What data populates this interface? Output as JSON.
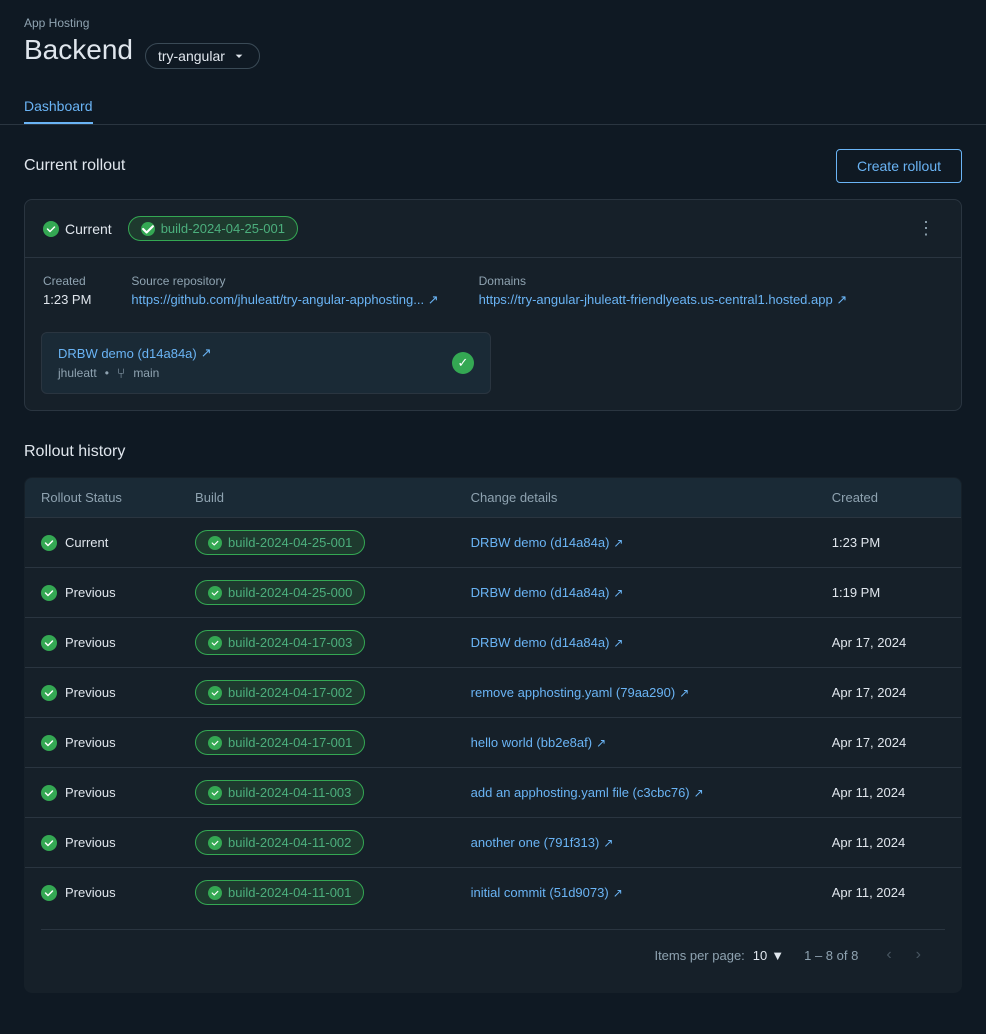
{
  "appLabel": "App Hosting",
  "backendTitle": "Backend",
  "branchSelector": {
    "label": "try-angular"
  },
  "tabs": [
    {
      "label": "Dashboard",
      "active": true
    }
  ],
  "currentRollout": {
    "sectionTitle": "Current rollout",
    "createButton": "Create rollout",
    "statusLabel": "Current",
    "buildBadge": "build-2024-04-25-001",
    "created": {
      "label": "Created",
      "value": "1:23 PM"
    },
    "sourceRepo": {
      "label": "Source repository",
      "link": "https://github.com/jhuleatt/try-angular-apphosting",
      "display": "https://github.com/jhuleatt/try-angular-apphosting..."
    },
    "domains": {
      "label": "Domains",
      "link": "https://try-angular-jhuleatt-friendlyeats.us-central1.hosted.app",
      "display": "https://try-angular-jhuleatt-friendlyeats.us-central1.hosted.app"
    },
    "commit": {
      "linkText": "DRBW demo (d14a84a)",
      "author": "jhuleatt",
      "branch": "main"
    }
  },
  "rolloutHistory": {
    "title": "Rollout history",
    "columns": [
      "Rollout Status",
      "Build",
      "Change details",
      "Created"
    ],
    "rows": [
      {
        "status": "Current",
        "build": "build-2024-04-25-001",
        "change": "DRBW demo (d14a84a)",
        "created": "1:23 PM"
      },
      {
        "status": "Previous",
        "build": "build-2024-04-25-000",
        "change": "DRBW demo (d14a84a)",
        "created": "1:19 PM"
      },
      {
        "status": "Previous",
        "build": "build-2024-04-17-003",
        "change": "DRBW demo (d14a84a)",
        "created": "Apr 17, 2024"
      },
      {
        "status": "Previous",
        "build": "build-2024-04-17-002",
        "change": "remove apphosting.yaml (79aa290)",
        "created": "Apr 17, 2024"
      },
      {
        "status": "Previous",
        "build": "build-2024-04-17-001",
        "change": "hello world (bb2e8af)",
        "created": "Apr 17, 2024"
      },
      {
        "status": "Previous",
        "build": "build-2024-04-11-003",
        "change": "add an apphosting.yaml file (c3cbc76)",
        "created": "Apr 11, 2024"
      },
      {
        "status": "Previous",
        "build": "build-2024-04-11-002",
        "change": "another one (791f313)",
        "created": "Apr 11, 2024"
      },
      {
        "status": "Previous",
        "build": "build-2024-04-11-001",
        "change": "initial commit (51d9073)",
        "created": "Apr 11, 2024"
      }
    ]
  },
  "pagination": {
    "itemsPerPageLabel": "Items per page:",
    "itemsPerPage": "10",
    "rangeLabel": "1 – 8 of 8"
  }
}
